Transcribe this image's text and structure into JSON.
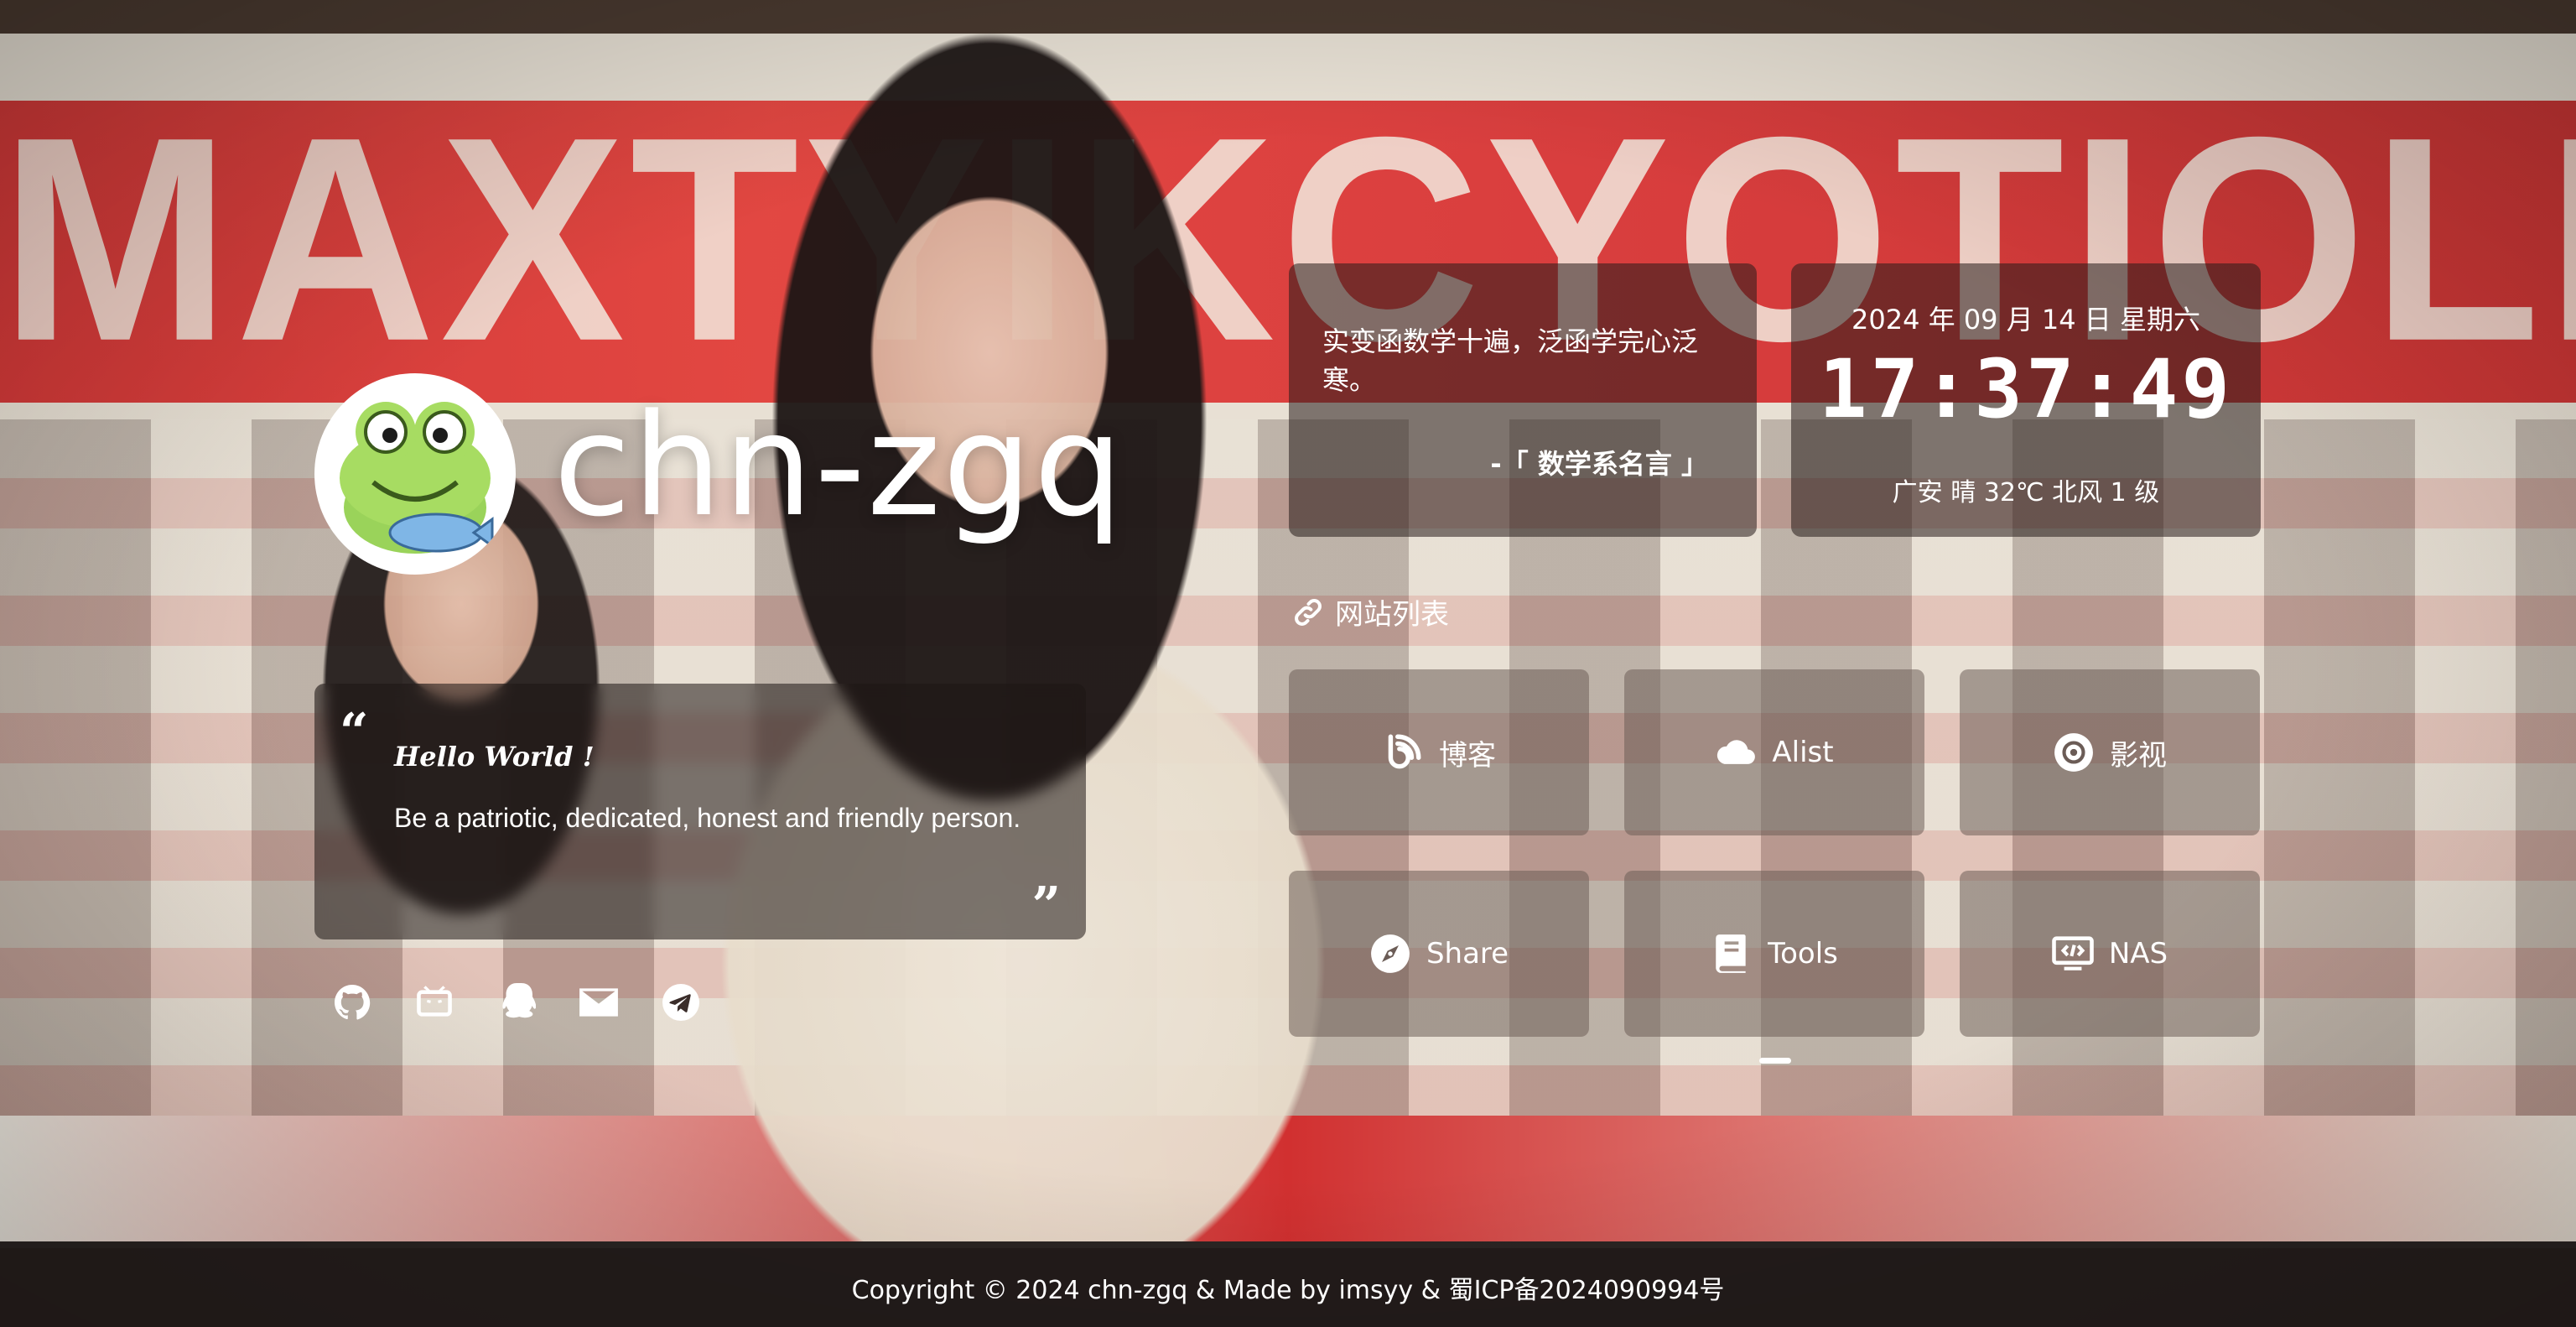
{
  "site": {
    "title": "chn-zgq"
  },
  "hello": {
    "title": "Hello World !",
    "text": "Be a patriotic, dedicated, honest and friendly person.",
    "open_quote": "“",
    "close_quote": "”"
  },
  "social": [
    {
      "name": "github-icon"
    },
    {
      "name": "bilibili-icon"
    },
    {
      "name": "qq-icon"
    },
    {
      "name": "email-icon"
    },
    {
      "name": "telegram-icon"
    }
  ],
  "motto": {
    "text": "实变函数学十遍，泛函学完心泛寒。",
    "from": "-「 数学系名言 」"
  },
  "time": {
    "date": "2024 年 09 月 14 日 星期六",
    "clock": "17:37:49",
    "weather": "广安 晴 32℃ 北风 1 级"
  },
  "site_list": {
    "heading": "网站列表",
    "items": [
      {
        "label": "博客",
        "icon": "blog-icon"
      },
      {
        "label": "Alist",
        "icon": "cloud-icon"
      },
      {
        "label": "影视",
        "icon": "disc-icon"
      },
      {
        "label": "Share",
        "icon": "compass-icon"
      },
      {
        "label": "Tools",
        "icon": "book-icon"
      },
      {
        "label": "NAS",
        "icon": "code-screen-icon"
      }
    ]
  },
  "footer": {
    "text": "Copyright  © 2024 chn-zgq & Made by imsyy & 蜀ICP备2024090994号"
  },
  "colors": {
    "card_bg": "#261c1a",
    "text": "#ffffff",
    "avatar_green": "#8fd14f"
  }
}
